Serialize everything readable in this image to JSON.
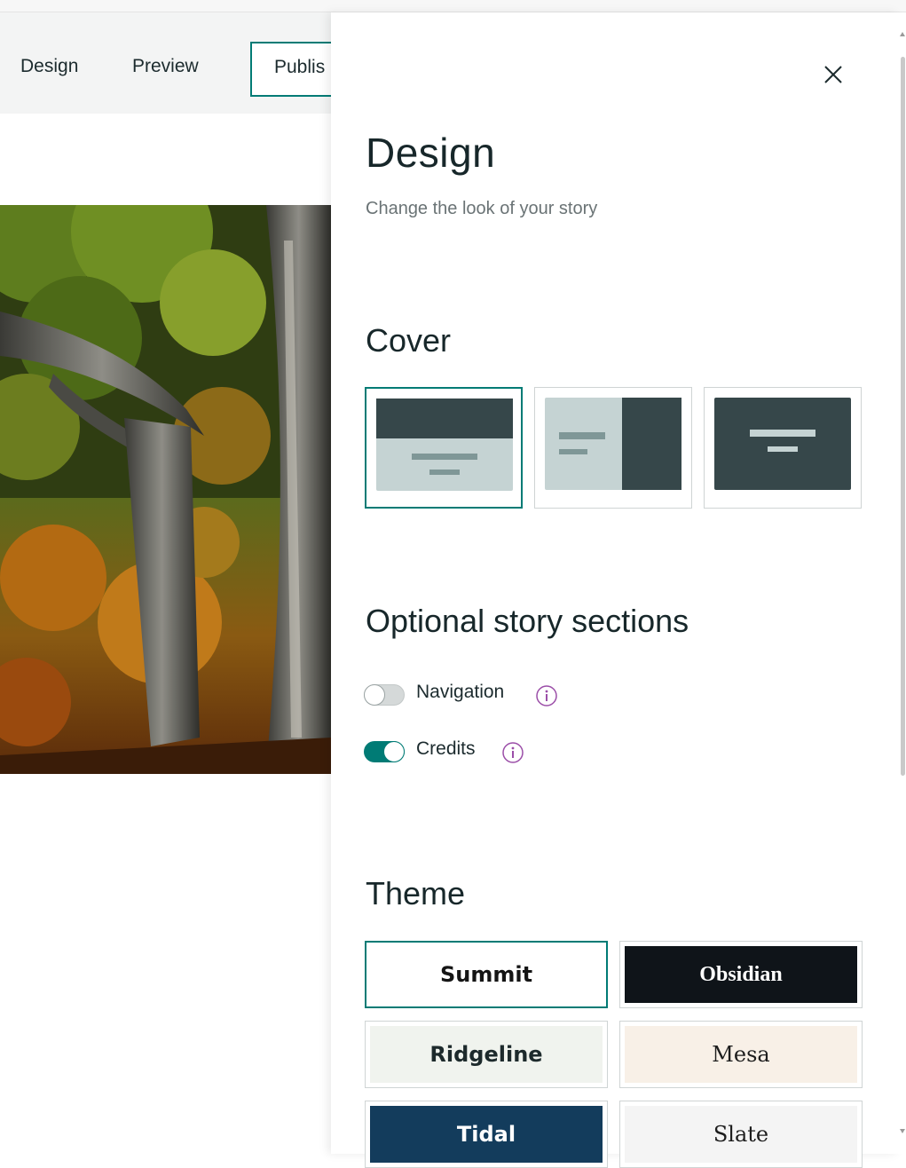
{
  "header": {
    "tabs": [
      {
        "label": "Design"
      },
      {
        "label": "Preview"
      }
    ],
    "publish_label": "Publis"
  },
  "drawer": {
    "title": "Design",
    "subtitle": "Change the look of your story",
    "close_icon": "close-icon",
    "cover": {
      "title": "Cover",
      "options": [
        {
          "name": "cover-layout-top-band",
          "selected": true
        },
        {
          "name": "cover-layout-side-panel",
          "selected": false
        },
        {
          "name": "cover-layout-full",
          "selected": false
        }
      ]
    },
    "optional_sections": {
      "title": "Optional story sections",
      "toggles": [
        {
          "label": "Navigation",
          "on": false,
          "icon": "info-icon"
        },
        {
          "label": "Credits",
          "on": true,
          "icon": "info-icon"
        }
      ]
    },
    "theme": {
      "title": "Theme",
      "options": [
        {
          "label": "Summit",
          "selected": true
        },
        {
          "label": "Obsidian",
          "selected": false
        },
        {
          "label": "Ridgeline",
          "selected": false
        },
        {
          "label": "Mesa",
          "selected": false
        },
        {
          "label": "Tidal",
          "selected": false
        },
        {
          "label": "Slate",
          "selected": false
        }
      ]
    }
  },
  "colors": {
    "accent": "#007b75",
    "cover_dark": "#36474a",
    "cover_light": "#c5d3d3",
    "info_icon": "#9b4ea8"
  }
}
